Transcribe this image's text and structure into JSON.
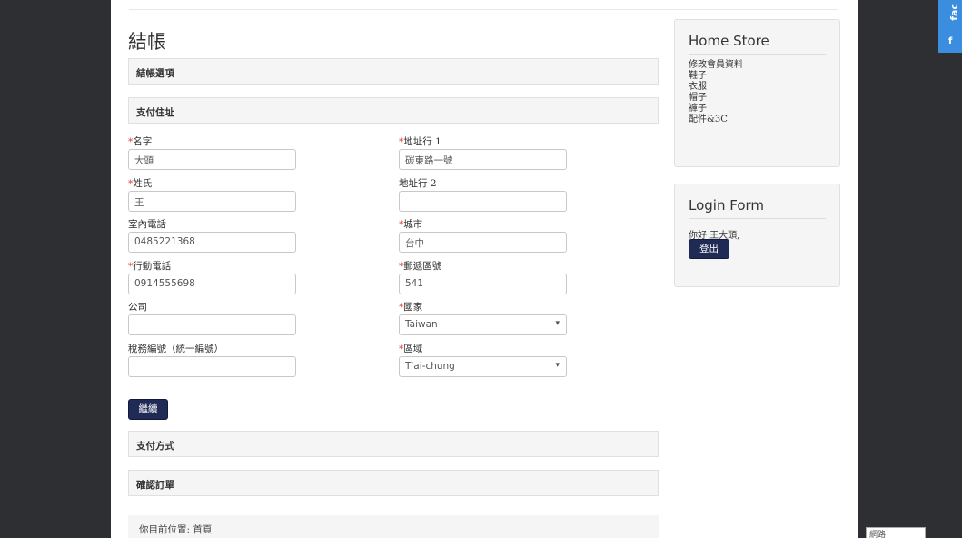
{
  "page_title": "結帳",
  "sections": {
    "checkout_options": "結帳選項",
    "payment_address": "支付住址",
    "payment_method": "支付方式",
    "confirm_order": "確認訂單"
  },
  "form": {
    "first_name": {
      "label": "名字",
      "value": "大頭"
    },
    "last_name": {
      "label": "姓氏",
      "value": "王"
    },
    "telephone": {
      "label": "室內電話",
      "value": "0485221368"
    },
    "mobile": {
      "label": "行動電話",
      "value": "0914555698"
    },
    "company": {
      "label": "公司",
      "value": ""
    },
    "tax_id": {
      "label": "稅務編號（統一編號）",
      "value": ""
    },
    "address1": {
      "label": "地址行 1",
      "value": "碳東路一號"
    },
    "address2": {
      "label": "地址行 2",
      "value": ""
    },
    "city": {
      "label": "城市",
      "value": "台中"
    },
    "postcode": {
      "label": "郵遞區號",
      "value": "541"
    },
    "country": {
      "label": "國家",
      "value": "Taiwan"
    },
    "region": {
      "label": "區域",
      "value": "T'ai-chung"
    },
    "required_mark": "*"
  },
  "continue_label": "繼續",
  "breadcrumb": "你目前位置:  首頁",
  "sidebar": {
    "store_title": "Home Store",
    "store_links": [
      "修改會員資料",
      "鞋子",
      "衣服",
      "帽子",
      "褲子",
      "配件&3C"
    ],
    "login_title": "Login Form",
    "greeting": "你好 王大頭,",
    "logout_label": "登出"
  },
  "facebook_tab": {
    "text": "fac",
    "icon": "f"
  },
  "network_box": "網路",
  "colors": {
    "button": "#1f2a55",
    "required": "#e04040",
    "facebook": "#3b8de0",
    "background": "#2d2f33"
  }
}
